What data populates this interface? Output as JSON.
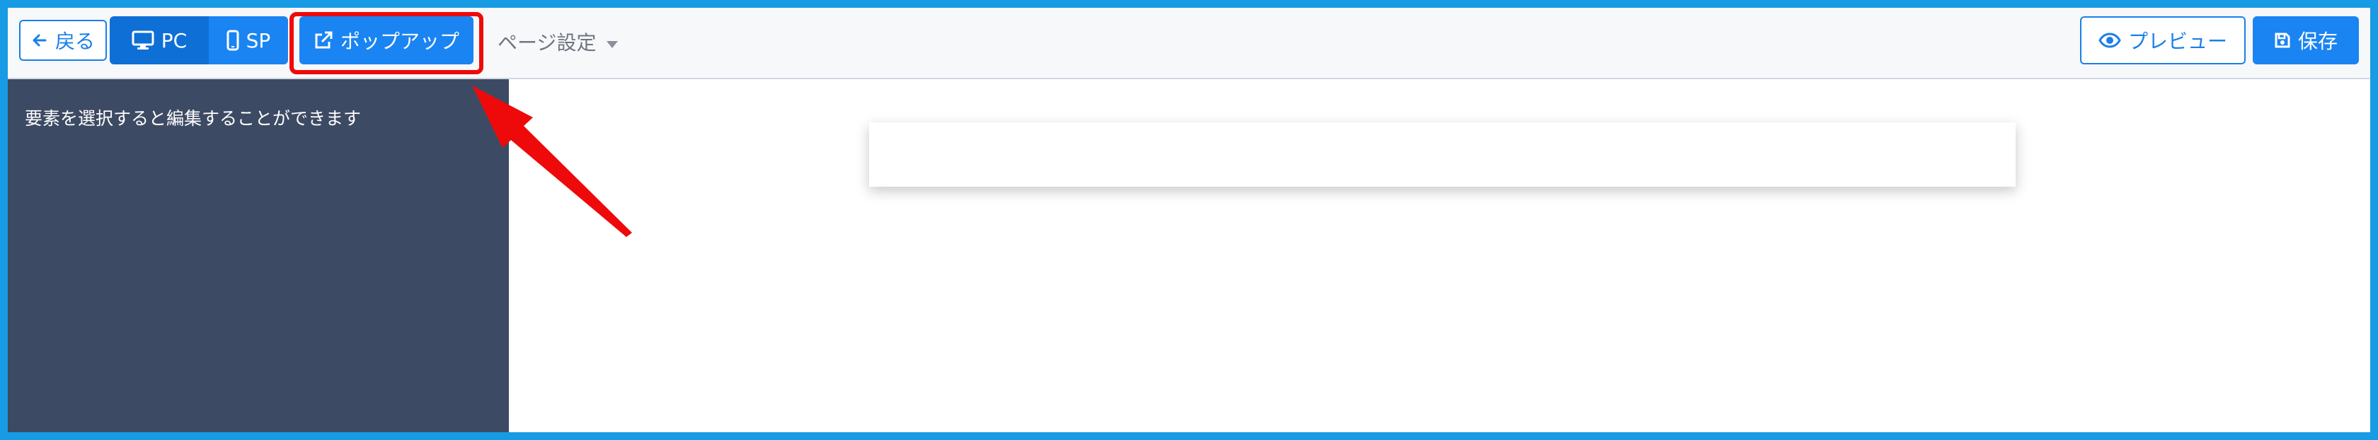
{
  "toolbar": {
    "back_label": "戻る",
    "pc_label": "PC",
    "sp_label": "SP",
    "popup_label": "ポップアップ",
    "page_settings_label": "ページ設定",
    "preview_label": "プレビュー",
    "save_label": "保存"
  },
  "sidebar": {
    "hint": "要素を選択すると編集することができます"
  },
  "colors": {
    "frame": "#179be4",
    "primary": "#1a84f2",
    "sidebar": "#3d4a63",
    "annotation": "#ee0a0a"
  },
  "icons": [
    "arrow-left-icon",
    "desktop-icon",
    "mobile-icon",
    "external-link-icon",
    "caret-down-icon",
    "eye-icon",
    "save-icon"
  ]
}
